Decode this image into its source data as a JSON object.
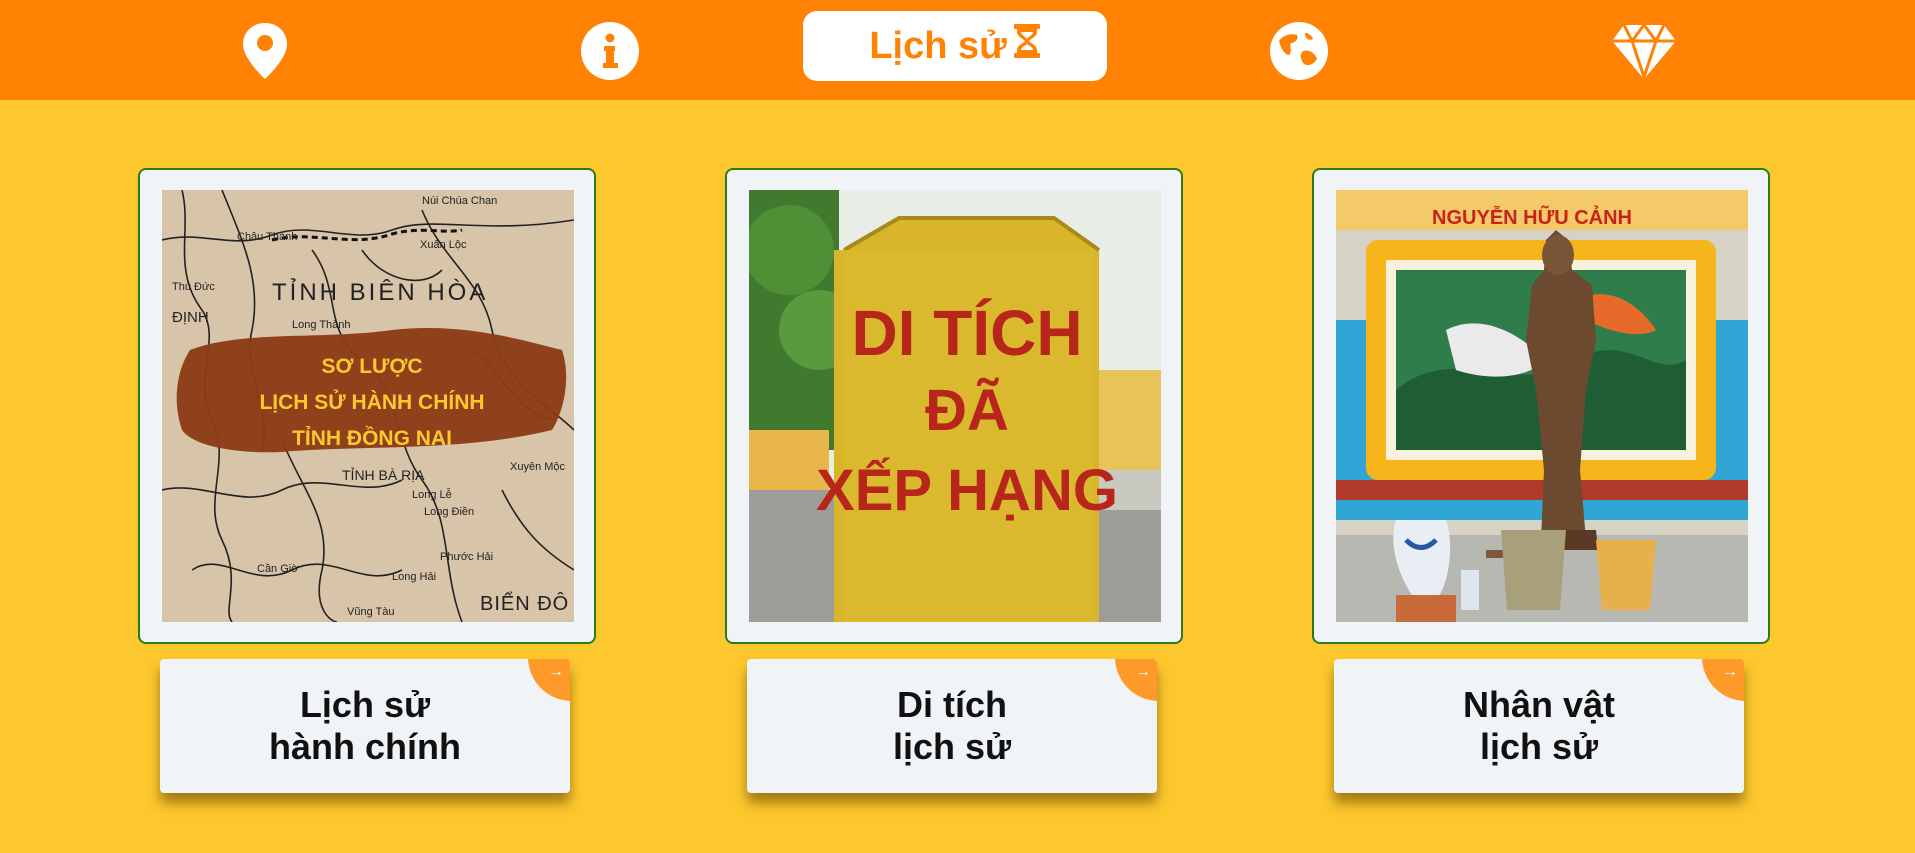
{
  "nav": {
    "items": [
      {
        "icon": "location-pin-icon"
      },
      {
        "icon": "info-icon"
      },
      {
        "icon": "globe-icon"
      },
      {
        "icon": "diamond-icon"
      }
    ],
    "active": {
      "label": "Lịch sử",
      "icon": "hourglass-icon"
    }
  },
  "cards": [
    {
      "image_text": [
        "SƠ LƯỢC",
        "LỊCH SỬ HÀNH CHÍNH",
        "TỈNH ĐỒNG NAI"
      ],
      "map_labels": [
        "TỈNH BIÊN HÒA",
        "TỈNH BÀ RỊA",
        "BIỂN ĐÔ",
        "Núi Chúa Chan",
        "Châu Thành",
        "Xuân Lộc",
        "Long Thành",
        "Xuyên Mộc",
        "Long Lễ",
        "Long Điền",
        "Phước Hải",
        "Long Hải",
        "Vũng Tàu",
        "Cần Giờ",
        "ĐỊNH",
        "Thủ Đức"
      ],
      "title_line1": "Lịch sử",
      "title_line2": "hành chính",
      "arrow": "→"
    },
    {
      "image_text": [
        "DI TÍCH",
        "ĐÃ",
        "XẾP HẠNG"
      ],
      "title_line1": "Di tích",
      "title_line2": "lịch sử",
      "arrow": "→"
    },
    {
      "image_text": [
        "NGUYỄN HỮU CẢNH"
      ],
      "title_line1": "Nhân vật",
      "title_line2": "lịch sử",
      "arrow": "→"
    }
  ]
}
